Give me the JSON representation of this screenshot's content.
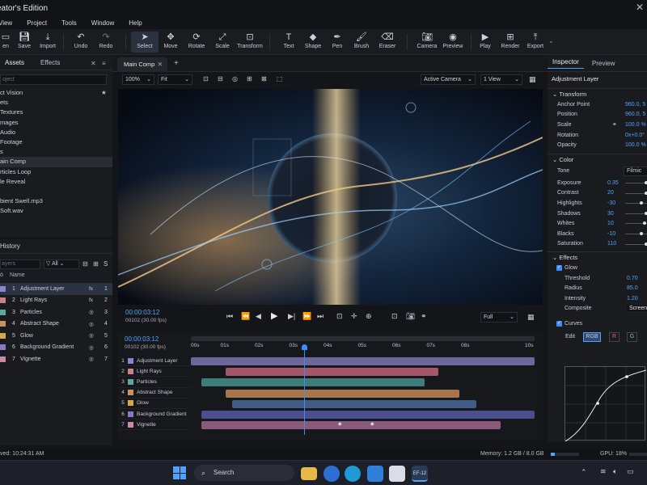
{
  "app": {
    "title": "eator's Edition"
  },
  "menu": [
    "View",
    "Project",
    "Tools",
    "Window",
    "Help"
  ],
  "toolbar": {
    "items": [
      {
        "label": "en",
        "icon": "open-icon"
      },
      {
        "label": "Save",
        "icon": "save-icon"
      },
      {
        "label": "Import",
        "icon": "import-icon"
      },
      {
        "label": "Undo",
        "icon": "undo-icon"
      },
      {
        "label": "Redo",
        "icon": "redo-icon"
      },
      {
        "label": "Select",
        "icon": "select-cursor-icon"
      },
      {
        "label": "Move",
        "icon": "move-icon"
      },
      {
        "label": "Rotate",
        "icon": "rotate-icon"
      },
      {
        "label": "Scale",
        "icon": "scale-icon"
      },
      {
        "label": "Transform",
        "icon": "transform-icon"
      },
      {
        "label": "Text",
        "icon": "text-icon"
      },
      {
        "label": "Shape",
        "icon": "shape-icon"
      },
      {
        "label": "Pen",
        "icon": "pen-icon"
      },
      {
        "label": "Brush",
        "icon": "brush-icon"
      },
      {
        "label": "Eraser",
        "icon": "eraser-icon"
      },
      {
        "label": "Camera",
        "icon": "camera-icon"
      },
      {
        "label": "Preview",
        "icon": "eye-icon"
      },
      {
        "label": "Play",
        "icon": "play-icon"
      },
      {
        "label": "Render",
        "icon": "render-icon"
      },
      {
        "label": "Export",
        "icon": "export-icon"
      }
    ]
  },
  "project": {
    "tabs": [
      "Assets",
      "Effects"
    ],
    "search_placeholder": "oject",
    "items": [
      "ct Vision",
      "ets",
      "Textures",
      "mages",
      "Audio",
      "Footage",
      "s",
      "ain Comp",
      "rticles Loop",
      "le Reveal",
      "",
      "bient Swell.mp3",
      "Soft.wav"
    ],
    "selected_index": 7
  },
  "layers_panel": {
    "title": "History",
    "search_placeholder": "ayers",
    "filter": "All",
    "col_name": "Name",
    "rows": [
      {
        "num": "1",
        "name": "Adjustment Layer",
        "right": "1",
        "color": "#8b86c9",
        "icon": "fx"
      },
      {
        "num": "2",
        "name": "Light Rays",
        "right": "2",
        "color": "#c97f8e",
        "icon": "fx"
      },
      {
        "num": "3",
        "name": "Particles",
        "right": "3",
        "color": "#5fa7a0",
        "icon": "◎"
      },
      {
        "num": "4",
        "name": "Abstract Shape",
        "right": "4",
        "color": "#c8935e",
        "icon": "◎"
      },
      {
        "num": "5",
        "name": "Glow",
        "right": "5",
        "color": "#d4a94a",
        "icon": "◎"
      },
      {
        "num": "6",
        "name": "Background Gradient",
        "right": "6",
        "color": "#8a78c0",
        "icon": "◎"
      },
      {
        "num": "7",
        "name": "Vignette",
        "right": "7",
        "color": "#c98aa6",
        "icon": "◎"
      }
    ]
  },
  "composition": {
    "tab": "Main Comp",
    "zoom": "100%",
    "fit": "Fit",
    "camera": "Active Camera",
    "view": "1 View",
    "timecode": "00:00:03:12",
    "frame": "00102 (30.00 fps)",
    "quality": "Full"
  },
  "timeline": {
    "timecode": "00:00:03:12",
    "frame": "00102 (30.00 fps)",
    "ticks": [
      "00s",
      "01s",
      "02s",
      "03s",
      "04s",
      "05s",
      "06s",
      "07s",
      "08s",
      "10s"
    ],
    "playhead_seconds": 3.3,
    "tracks": [
      {
        "num": "1",
        "name": "Adjustment Layer",
        "color": "#8b86c9",
        "bar": "#6d679b",
        "start": 0.0,
        "end": 10.0
      },
      {
        "num": "2",
        "name": "Light Rays",
        "color": "#c97f8e",
        "bar": "#a4566a",
        "start": 1.0,
        "end": 7.2
      },
      {
        "num": "3",
        "name": "Particles",
        "color": "#5fa7a0",
        "bar": "#3f7d7b",
        "start": 0.3,
        "end": 6.8
      },
      {
        "num": "4",
        "name": "Abstract Shape",
        "color": "#c8935e",
        "bar": "#a8764d",
        "start": 1.0,
        "end": 7.8
      },
      {
        "num": "5",
        "name": "Glow",
        "color": "#d4a94a",
        "bar": "#3f5d87",
        "start": 1.2,
        "end": 8.3
      },
      {
        "num": "6",
        "name": "Background Gradient",
        "color": "#8a78c0",
        "bar": "#4c4f8f",
        "start": 0.3,
        "end": 10.0
      },
      {
        "num": "7",
        "name": "Vignette",
        "color": "#c98aa6",
        "bar": "#8a5a7d",
        "start": 0.3,
        "end": 9.0
      }
    ]
  },
  "inspector": {
    "tabs": [
      "Inspector",
      "Preview"
    ],
    "layer_name": "Adjustment Layer",
    "transform": {
      "title": "Transform",
      "rows": [
        {
          "k": "Anchor Point",
          "v": "960.0, 5"
        },
        {
          "k": "Position",
          "v": "960.0, 5"
        },
        {
          "k": "Scale",
          "v": "100.0 %"
        },
        {
          "k": "Rotation",
          "v": "0x+0.0°"
        },
        {
          "k": "Opacity",
          "v": "100.0 %"
        }
      ]
    },
    "color": {
      "title": "Color",
      "tone_label": "Tone",
      "tone_value": "Filmic",
      "rows": [
        {
          "k": "Exposure",
          "v": "0.35",
          "level": 0.6
        },
        {
          "k": "Contrast",
          "v": "20",
          "level": 0.6
        },
        {
          "k": "Highlights",
          "v": "-30",
          "level": 0.45
        },
        {
          "k": "Shadows",
          "v": "30",
          "level": 0.6
        },
        {
          "k": "Whites",
          "v": "10",
          "level": 0.55
        },
        {
          "k": "Blacks",
          "v": "-10",
          "level": 0.45
        },
        {
          "k": "Saturation",
          "v": "110",
          "level": 0.6
        }
      ]
    },
    "effects": {
      "title": "Effects",
      "glow": {
        "label": "Glow",
        "rows": [
          {
            "k": "Threshold",
            "v": "0.70"
          },
          {
            "k": "Radius",
            "v": "85.0"
          },
          {
            "k": "Intensity",
            "v": "1.20"
          },
          {
            "k": "Composite",
            "v": "Screen"
          }
        ]
      },
      "curves": {
        "label": "Curves",
        "edit": "Edit",
        "channels": [
          "RGB",
          "R",
          "G"
        ]
      }
    }
  },
  "status": {
    "saved": "ved: 10:24:31 AM",
    "memory": "Memory: 1.2 GB / 8.0 GB",
    "gpu": "GPU: 18%",
    "memory_fraction": 0.15
  },
  "taskbar": {
    "search": "Search",
    "app_badge": "EF-12"
  },
  "colors": {
    "accent": "#4fa3ff",
    "playhead": "#3b8cff"
  }
}
